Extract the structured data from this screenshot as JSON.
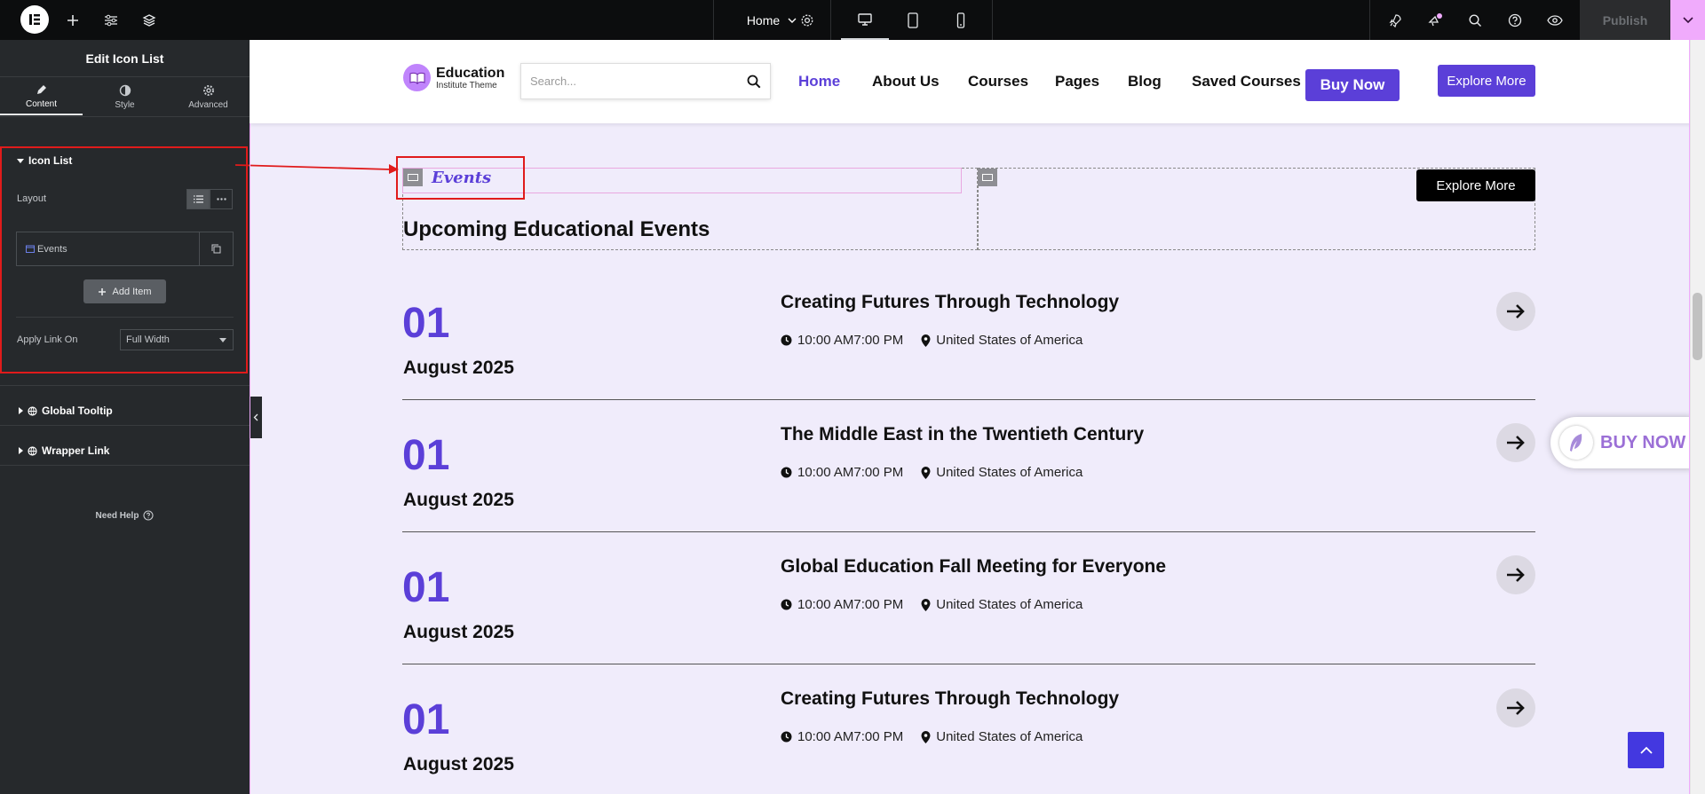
{
  "topbar": {
    "page_label": "Home",
    "publish_label": "Publish",
    "icons": [
      "elementor-logo-icon",
      "add-icon",
      "sliders-icon",
      "layers-icon",
      "settings-icon",
      "desktop-icon",
      "tablet-icon",
      "mobile-icon",
      "rocket-icon",
      "notifications-icon",
      "search-icon",
      "help-icon",
      "preview-eye-icon"
    ]
  },
  "panel": {
    "title": "Edit Icon List",
    "tabs": [
      {
        "label": "Content",
        "icon": "pencil-icon"
      },
      {
        "label": "Style",
        "icon": "contrast-icon"
      },
      {
        "label": "Advanced",
        "icon": "gear-icon"
      }
    ],
    "icon_list": {
      "heading": "Icon List",
      "layout_label": "Layout",
      "item_label": "Events",
      "add_item_label": "Add Item",
      "apply_link_label": "Apply Link On",
      "apply_link_value": "Full Width"
    },
    "global_tooltip": "Global Tooltip",
    "wrapper_link": "Wrapper Link",
    "need_help": "Need Help"
  },
  "site": {
    "brand_name": "Education",
    "brand_sub": "Institute Theme",
    "search_placeholder": "Search...",
    "nav": [
      "Home",
      "About Us",
      "Courses",
      "Pages",
      "Blog",
      "Saved Courses"
    ],
    "buy_now": "Buy Now",
    "explore_more": "Explore More",
    "events_label": "Events",
    "explore_more_dark": "Explore More",
    "section_title": "Upcoming Educational Events",
    "events": [
      {
        "day": "01",
        "month": "August 2025",
        "title": "Creating Futures Through Technology",
        "time": "10:00 AM7:00 PM",
        "location": "United States of America"
      },
      {
        "day": "01",
        "month": "August 2025",
        "title": "The Middle East in the Twentieth Century",
        "time": "10:00 AM7:00 PM",
        "location": "United States of America"
      },
      {
        "day": "01",
        "month": "August 2025",
        "title": "Global Education Fall Meeting for Everyone",
        "time": "10:00 AM7:00 PM",
        "location": "United States of America"
      },
      {
        "day": "01",
        "month": "August 2025",
        "title": "Creating Futures Through Technology",
        "time": "10:00 AM7:00 PM",
        "location": "United States of America"
      }
    ],
    "buy_now_float": "BUY NOW"
  },
  "colors": {
    "accent": "#5b3fd8",
    "editor_dark": "#26292c",
    "highlight_red": "#e01b1b",
    "page_bg": "#f0ecfb"
  }
}
